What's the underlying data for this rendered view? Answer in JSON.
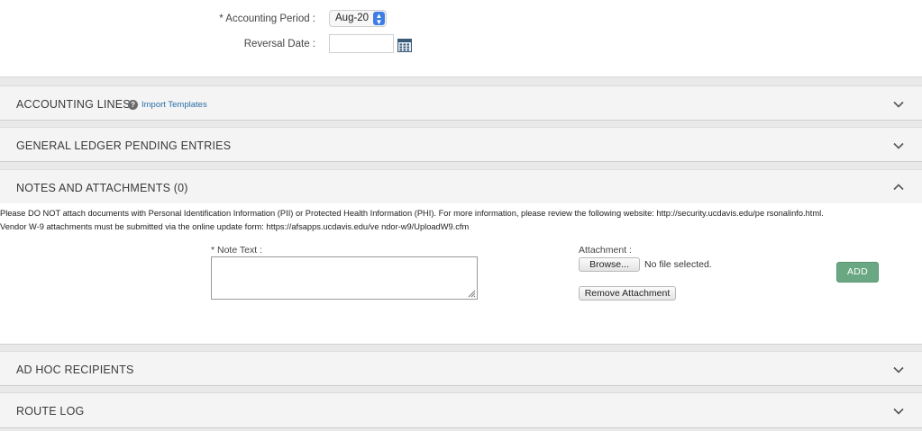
{
  "form": {
    "accounting_period_label": "* Accounting Period :",
    "accounting_period_value": "Aug-20",
    "reversal_date_label": "Reversal Date :",
    "reversal_date_value": ""
  },
  "sections": {
    "accounting_lines": {
      "title": "ACCOUNTING LINES",
      "import_link": "Import Templates"
    },
    "gl_pending": {
      "title": "GENERAL LEDGER PENDING ENTRIES"
    },
    "notes": {
      "title": "NOTES AND ATTACHMENTS (0)"
    },
    "ad_hoc": {
      "title": "AD HOC RECIPIENTS"
    },
    "route_log": {
      "title": "ROUTE LOG"
    }
  },
  "notes_panel": {
    "warning_line1": "Please DO NOT attach documents with Personal Identification Information (PII) or Protected Health Information (PHI). For more information, please review the following website: http://security.ucdavis.edu/pe rsonalinfo.html.",
    "warning_line2": "Vendor W-9 attachments must be submitted via the online update form: https://afsapps.ucdavis.edu/ve ndor-w9/UploadW9.cfm",
    "note_text_label": "* Note Text :",
    "note_text_value": "",
    "attachment_label": "Attachment :",
    "browse_label": "Browse...",
    "no_file_text": "No file selected.",
    "remove_attachment_label": "Remove Attachment",
    "add_label": "ADD"
  },
  "icons": {
    "help": "help-circle-icon",
    "calendar": "calendar-icon",
    "expand": "chevron-down-icon",
    "collapse": "chevron-up-icon",
    "select_arrows": "select-arrows-icon"
  },
  "colors": {
    "link": "#2a6ea6",
    "add_button": "#6aa883",
    "select_accent": "#3d7ee6"
  }
}
